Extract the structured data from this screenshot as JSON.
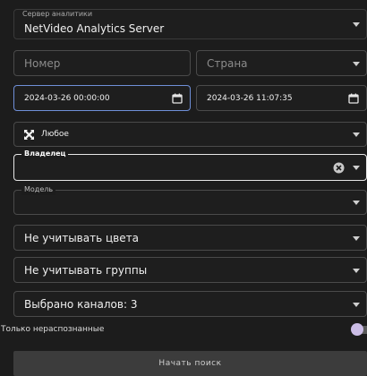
{
  "server": {
    "legend": "Сервер аналитики",
    "value": "NetVideo Analytics Server"
  },
  "number": {
    "placeholder": "Номер"
  },
  "country": {
    "placeholder": "Страна"
  },
  "date_from": {
    "value": "2024-03-26 00:00:00"
  },
  "date_to": {
    "value": "2024-03-26 11:07:35"
  },
  "direction": {
    "value": "Любое"
  },
  "owner": {
    "legend": "Владелец",
    "value": ""
  },
  "model": {
    "legend": "Модель",
    "value": ""
  },
  "colors": {
    "value": "Не учитывать цвета"
  },
  "groups": {
    "value": "Не учитывать группы"
  },
  "channels": {
    "value": "Выбрано каналов: 3"
  },
  "unrecognized": {
    "label": "Только нераспознанные",
    "checked": false
  },
  "search_button": {
    "label": "Начать поиск"
  },
  "colors_palette": {
    "background": "#1c1c1c",
    "border": "#4a4a4a",
    "toggle_thumb": "#cbbde6"
  }
}
